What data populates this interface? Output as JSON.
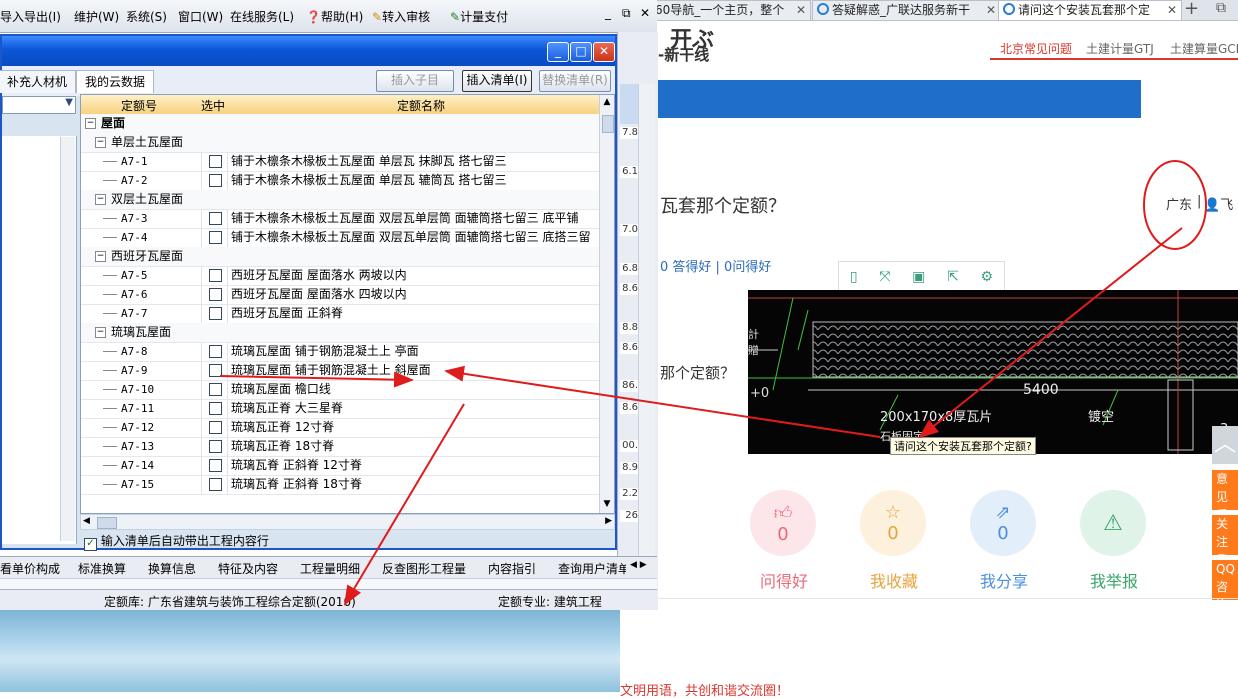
{
  "app": {
    "menu": [
      "导入导出(I)",
      "维护(W)",
      "系统(S)",
      "窗口(W)",
      "在线服务(L)",
      "帮助(H)",
      "转入审核",
      "计量支付"
    ],
    "right_values": [
      "7.8",
      "6.1",
      "7.0",
      "6.8",
      "8.6",
      "8.8",
      "8.6",
      "86.",
      "8.6",
      "00.",
      "8.9",
      "2.2",
      "26"
    ]
  },
  "dialog": {
    "tabs": [
      "补充人材机",
      "我的云数据"
    ],
    "buttons": {
      "insert_child": "插入子目",
      "insert_list": "插入清单(I)",
      "replace_list": "替换清单(R)"
    },
    "columns": [
      "定额号",
      "选中",
      "定额名称"
    ],
    "tree": [
      {
        "type": "root",
        "label": "屋面"
      },
      {
        "type": "group",
        "label": "单层土瓦屋面"
      },
      {
        "type": "item",
        "code": "A7-1",
        "name": "铺于木檩条木椽板土瓦屋面 单层瓦 抹脚瓦 搭七留三"
      },
      {
        "type": "item",
        "code": "A7-2",
        "name": "铺于木檩条木椽板土瓦屋面 单层瓦 辘筒瓦 搭七留三"
      },
      {
        "type": "group",
        "label": "双层土瓦屋面"
      },
      {
        "type": "item",
        "code": "A7-3",
        "name": "铺于木檩条木椽板土瓦屋面 双层瓦单层筒 面辘筒搭七留三 底平铺"
      },
      {
        "type": "item",
        "code": "A7-4",
        "name": "铺于木檩条木椽板土瓦屋面 双层瓦单层筒 面辘筒搭七留三 底搭三留"
      },
      {
        "type": "group",
        "label": "西班牙瓦屋面"
      },
      {
        "type": "item",
        "code": "A7-5",
        "name": "西班牙瓦屋面 屋面落水 两坡以内"
      },
      {
        "type": "item",
        "code": "A7-6",
        "name": "西班牙瓦屋面 屋面落水 四坡以内"
      },
      {
        "type": "item",
        "code": "A7-7",
        "name": "西班牙瓦屋面 正斜脊"
      },
      {
        "type": "group",
        "label": "琉璃瓦屋面"
      },
      {
        "type": "item",
        "code": "A7-8",
        "name": "琉璃瓦屋面 铺于钢筋混凝土上 亭面"
      },
      {
        "type": "item",
        "code": "A7-9",
        "name": "琉璃瓦屋面 铺于钢筋混凝土上 斜屋面"
      },
      {
        "type": "item",
        "code": "A7-10",
        "name": "琉璃瓦屋面 檐口线"
      },
      {
        "type": "item",
        "code": "A7-11",
        "name": "琉璃瓦正脊 大三星脊"
      },
      {
        "type": "item",
        "code": "A7-12",
        "name": "琉璃瓦正脊 12寸脊"
      },
      {
        "type": "item",
        "code": "A7-13",
        "name": "琉璃瓦正脊 18寸脊"
      },
      {
        "type": "item",
        "code": "A7-14",
        "name": "琉璃瓦脊 正斜脊 12寸脊"
      },
      {
        "type": "item",
        "code": "A7-15",
        "name": "琉璃瓦脊 正斜脊 18寸脊"
      }
    ],
    "auto_bring": "输入清单后自动带出工程内容行"
  },
  "bottom_tabs": [
    "看单价构成",
    "标准换算",
    "换算信息",
    "特征及内容",
    "工程量明细",
    "反查图形工程量",
    "内容指引",
    "查询用户清单"
  ],
  "status": {
    "library": "定额库: 广东省建筑与装饰工程综合定额(2010)",
    "specialty": "定额专业: 建筑工程"
  },
  "browser": {
    "tabs": [
      "60导航_一个主页，整个",
      "答疑解惑_广联达服务新干",
      "请问这个安装瓦套那个定"
    ],
    "site_sub": "新干线",
    "top_links": [
      "北京常见问题",
      "土建计量GTJ",
      "土建算量GCL"
    ],
    "question_title": "瓦套那个定额？",
    "location": "广东",
    "user": "飞",
    "stats": "0 答得好 | 0问得好",
    "question_repeat": "那个定额？",
    "cad": {
      "dim": "5400",
      "lbl1": "200x170x8厚瓦片",
      "lbl2": "镀空",
      "lbl3": "石板固定",
      "plus": "+0",
      "num": "3"
    },
    "tooltip": "请问这个安装瓦套那个定额?",
    "actions": [
      {
        "label": "问得好",
        "count": "0",
        "color": "#e96b7a",
        "bg": "#fde6e9",
        "icon": "thumbs-up-icon"
      },
      {
        "label": "我收藏",
        "count": "0",
        "color": "#e8a33d",
        "bg": "#fdf0dc",
        "icon": "star-icon"
      },
      {
        "label": "我分享",
        "count": "0",
        "color": "#4a8fe0",
        "bg": "#e3eefb",
        "icon": "share-icon"
      },
      {
        "label": "我举报",
        "count": "",
        "color": "#3aa56b",
        "bg": "#dff3e8",
        "icon": "warning-icon"
      }
    ],
    "side": [
      "意见反馈",
      "关注我们",
      "QQ咨询"
    ],
    "footer": "文明用语，共创和谐交流圈！"
  },
  "colors": {
    "annotation": "#e01b1b",
    "dialog_title": "#0b56d8",
    "header_bar": "#1f6fc9"
  }
}
